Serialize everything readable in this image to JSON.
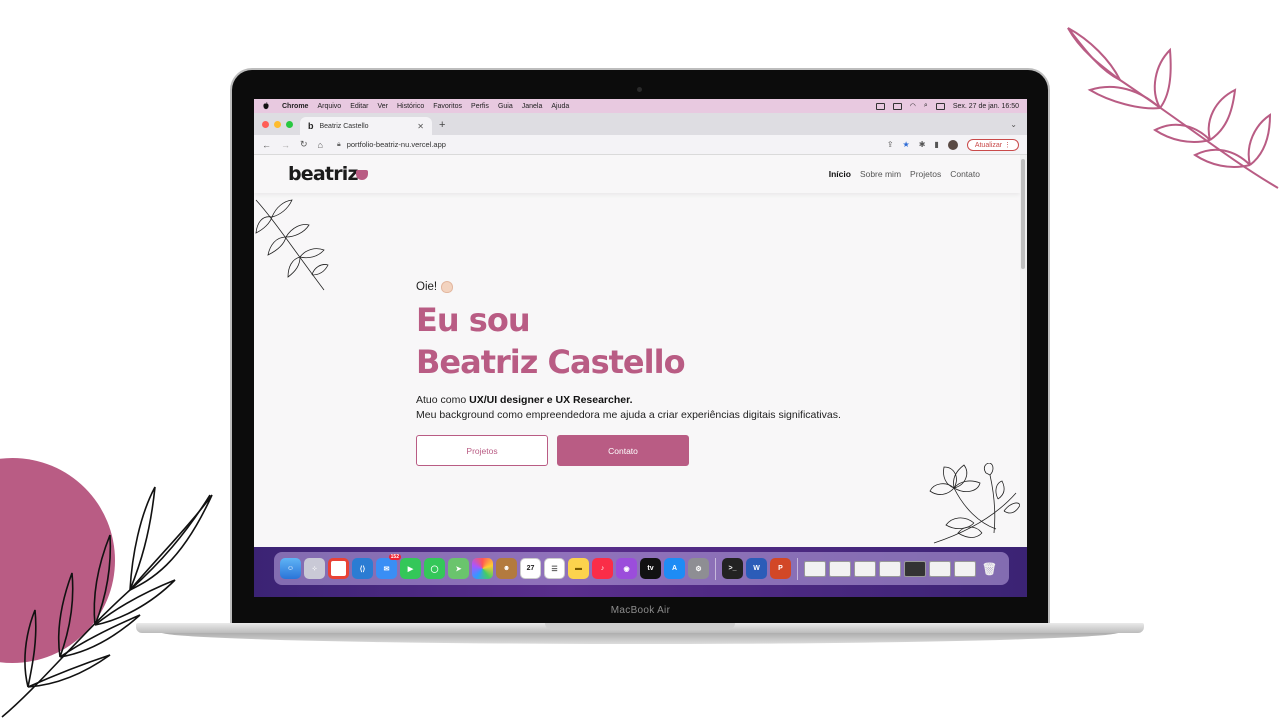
{
  "menubar": {
    "app": "Chrome",
    "items": [
      "Arquivo",
      "Editar",
      "Ver",
      "Histórico",
      "Favoritos",
      "Perfis",
      "Guia",
      "Janela",
      "Ajuda"
    ],
    "clock": "Sex. 27 de jan.  16:50"
  },
  "browser": {
    "tab_title": "Beatriz Castello",
    "tab_favicon": "b",
    "url": "portfolio-beatriz-nu.vercel.app",
    "update_label": "Atualizar"
  },
  "site": {
    "logo": "beatriz",
    "nav": [
      "Início",
      "Sobre mim",
      "Projetos",
      "Contato"
    ],
    "hero": {
      "greeting": "Oie!",
      "title_line1": "Eu sou",
      "title_line2": "Beatriz Castello",
      "desc_prefix": "Atuo como ",
      "desc_bold": "UX/UI designer e UX Researcher.",
      "desc_line2": "Meu background como empreendedora me ajuda a criar experiências digitais significativas.",
      "btn_projects": "Projetos",
      "btn_contact": "Contato"
    }
  },
  "dock": {
    "calendar_day": "27",
    "mail_badge": "152"
  },
  "laptop_model": "MacBook Air",
  "colors": {
    "accent": "#b95c84",
    "menubar": "#e8c9e0"
  }
}
